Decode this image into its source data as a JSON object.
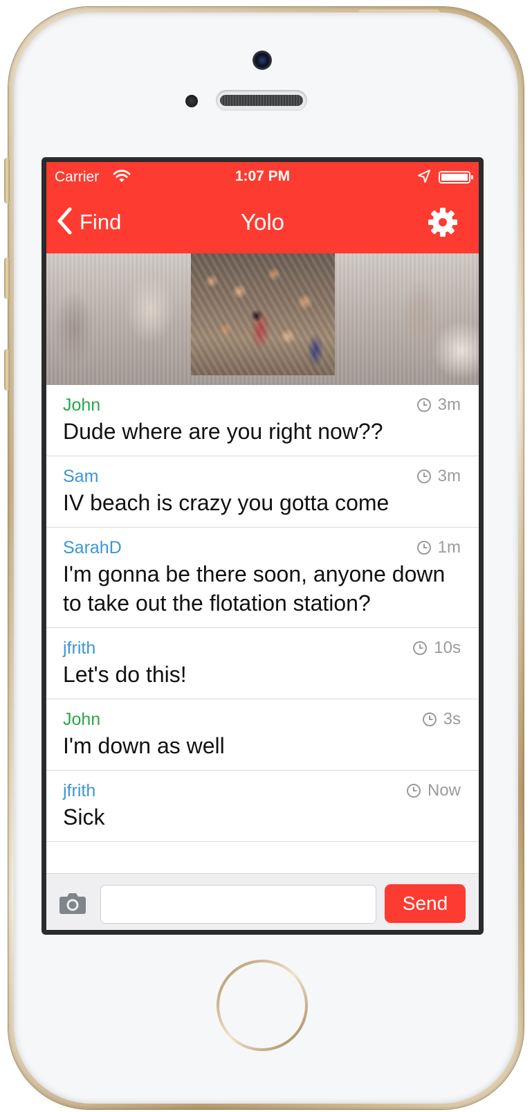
{
  "status_bar": {
    "carrier": "Carrier",
    "time": "1:07 PM",
    "wifi_icon": "wifi-icon",
    "location_icon": "location-arrow-icon",
    "battery_icon": "battery-icon"
  },
  "nav": {
    "back_label": "Find",
    "back_icon": "chevron-left-icon",
    "title": "Yolo",
    "settings_icon": "gear-icon"
  },
  "colors": {
    "accent": "#fd3b31",
    "author_green": "#27a84a",
    "author_blue": "#3a96d8",
    "timestamp": "#9b9b9b"
  },
  "messages": [
    {
      "author": "John",
      "author_color": "green",
      "time": "3m",
      "text": "Dude where are you right now??"
    },
    {
      "author": "Sam",
      "author_color": "blue",
      "time": "3m",
      "text": "IV beach is crazy you gotta come"
    },
    {
      "author": "SarahD",
      "author_color": "blue",
      "time": "1m",
      "text": "I'm gonna be there soon, anyone down to take out the flotation station?"
    },
    {
      "author": "jfrith",
      "author_color": "blue",
      "time": "10s",
      "text": "Let's do this!"
    },
    {
      "author": "John",
      "author_color": "green",
      "time": "3s",
      "text": "I'm down as well"
    },
    {
      "author": "jfrith",
      "author_color": "blue",
      "time": "Now",
      "text": "Sick"
    }
  ],
  "compose": {
    "camera_icon": "camera-icon",
    "input_value": "",
    "input_placeholder": "",
    "send_label": "Send"
  }
}
